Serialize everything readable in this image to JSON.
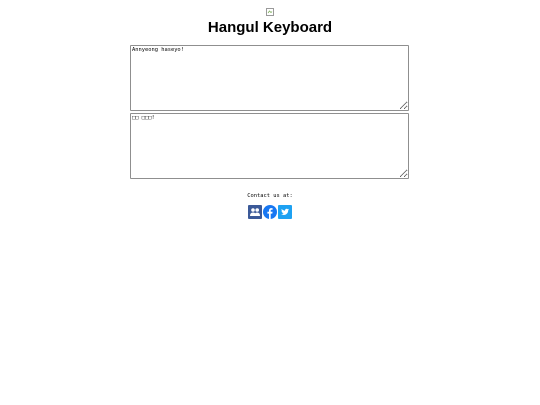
{
  "header": {
    "title": "Hangul Keyboard"
  },
  "editor": {
    "romanized_value": "Annyeong haseyo!",
    "hangul_value": "□□ □□□!"
  },
  "footer": {
    "contact_label": "Contact us at:",
    "social_links": [
      {
        "name": "community-icon",
        "color": "#3b5998"
      },
      {
        "name": "facebook-icon",
        "color": "#1877f2"
      },
      {
        "name": "twitter-icon",
        "color": "#1da1f2"
      }
    ]
  }
}
